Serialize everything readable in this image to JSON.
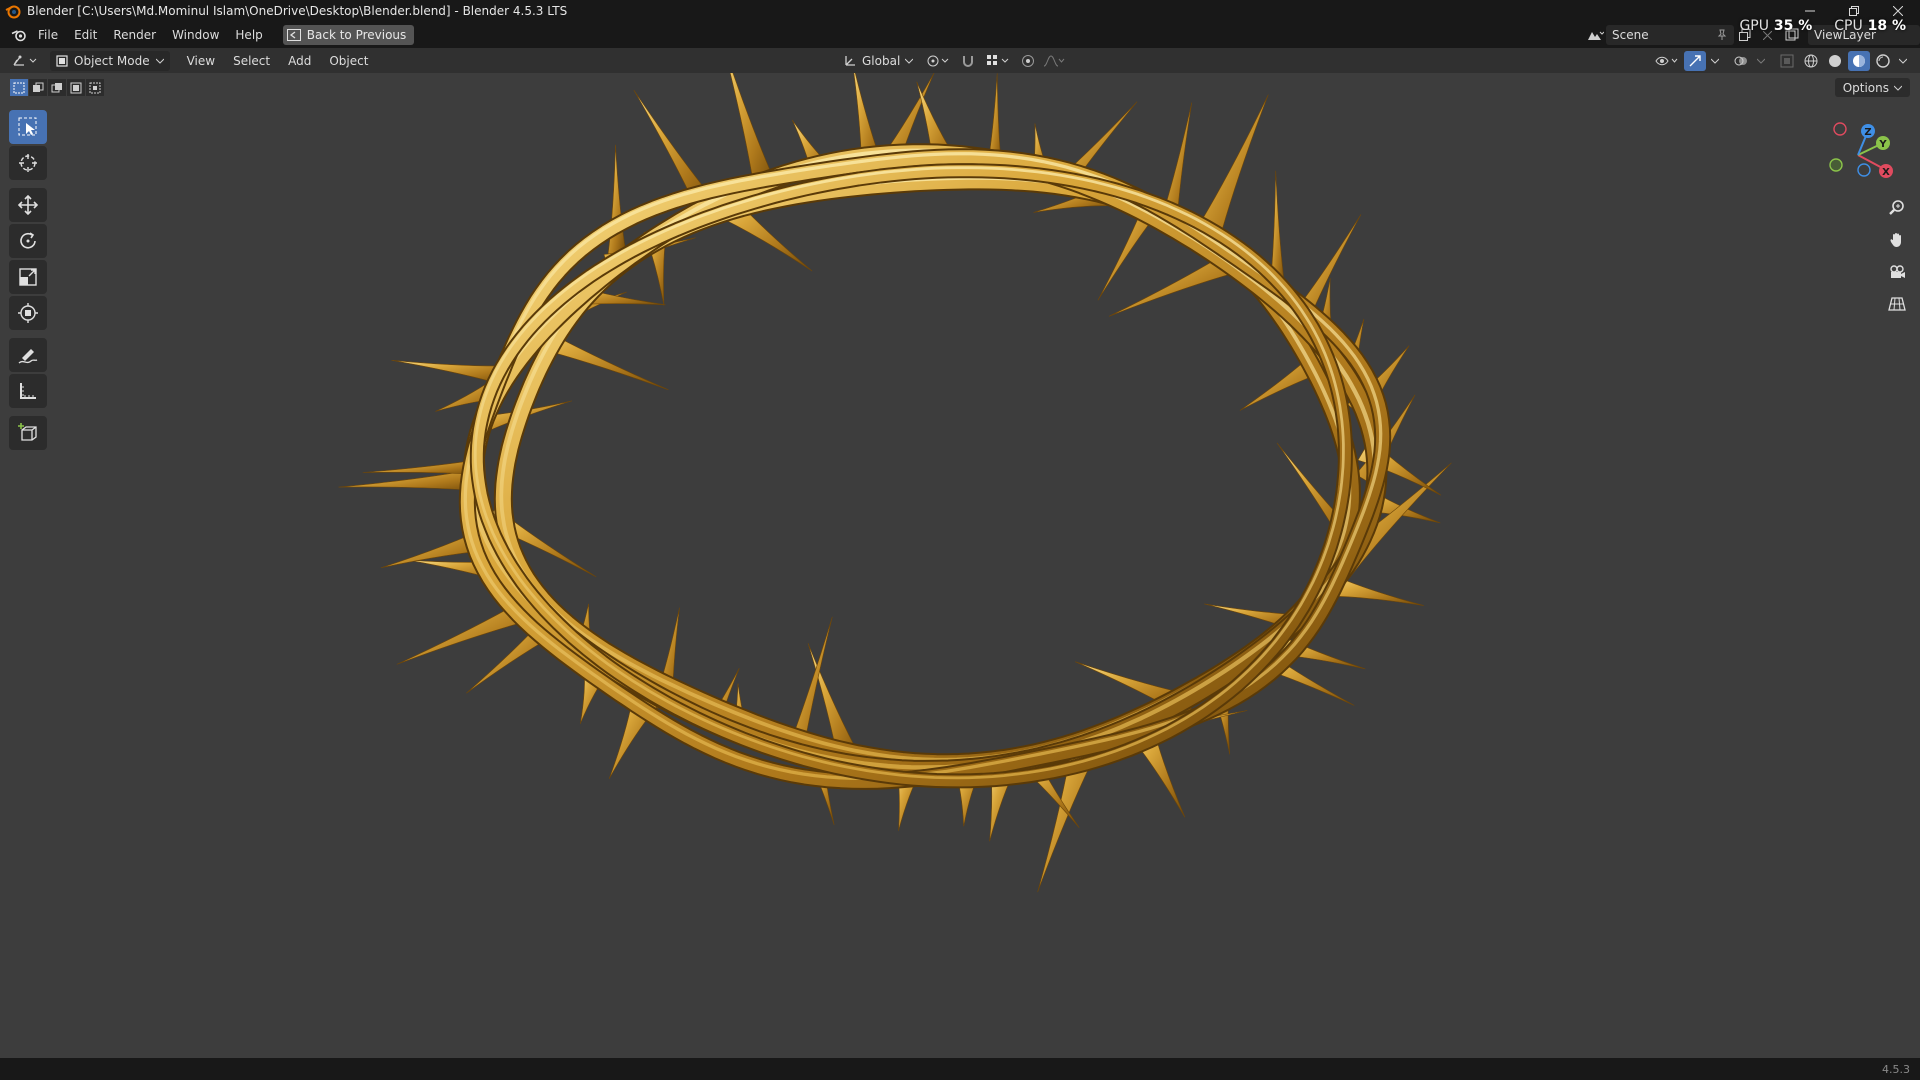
{
  "window": {
    "title": "Blender [C:\\Users\\Md.Mominul Islam\\OneDrive\\Desktop\\Blender.blend] - Blender 4.5.3 LTS",
    "controls": [
      "minimize",
      "restore",
      "close"
    ]
  },
  "menubar": {
    "items": [
      "File",
      "Edit",
      "Render",
      "Window",
      "Help"
    ],
    "back_button": "Back to Previous",
    "scene": "Scene",
    "view_layer": "ViewLayer"
  },
  "stats": {
    "gpu_label": "GPU",
    "gpu_value": "35 %",
    "cpu_label": "CPU",
    "cpu_value": "18 %"
  },
  "viewport_header": {
    "mode": "Object Mode",
    "menus": [
      "View",
      "Select",
      "Add",
      "Object"
    ],
    "orientation": "Global"
  },
  "viewport": {
    "options_label": "Options",
    "tools": [
      "select-box",
      "cursor",
      "move",
      "rotate",
      "scale",
      "transform",
      "annotate",
      "measure",
      "add-cube"
    ],
    "active_tool": "select-box",
    "gizmo_axes": [
      "X",
      "Y",
      "Z"
    ],
    "nav": [
      "zoom",
      "pan",
      "camera",
      "perspective"
    ]
  },
  "colors": {
    "accent": "#4772b3",
    "background": "#3d3d3d",
    "axis_x": "#e04b5f",
    "axis_y": "#8bc34a",
    "axis_z": "#3f8fe6",
    "gold": "#d9a63a"
  },
  "statusbar": {
    "version": "4.5.3"
  }
}
